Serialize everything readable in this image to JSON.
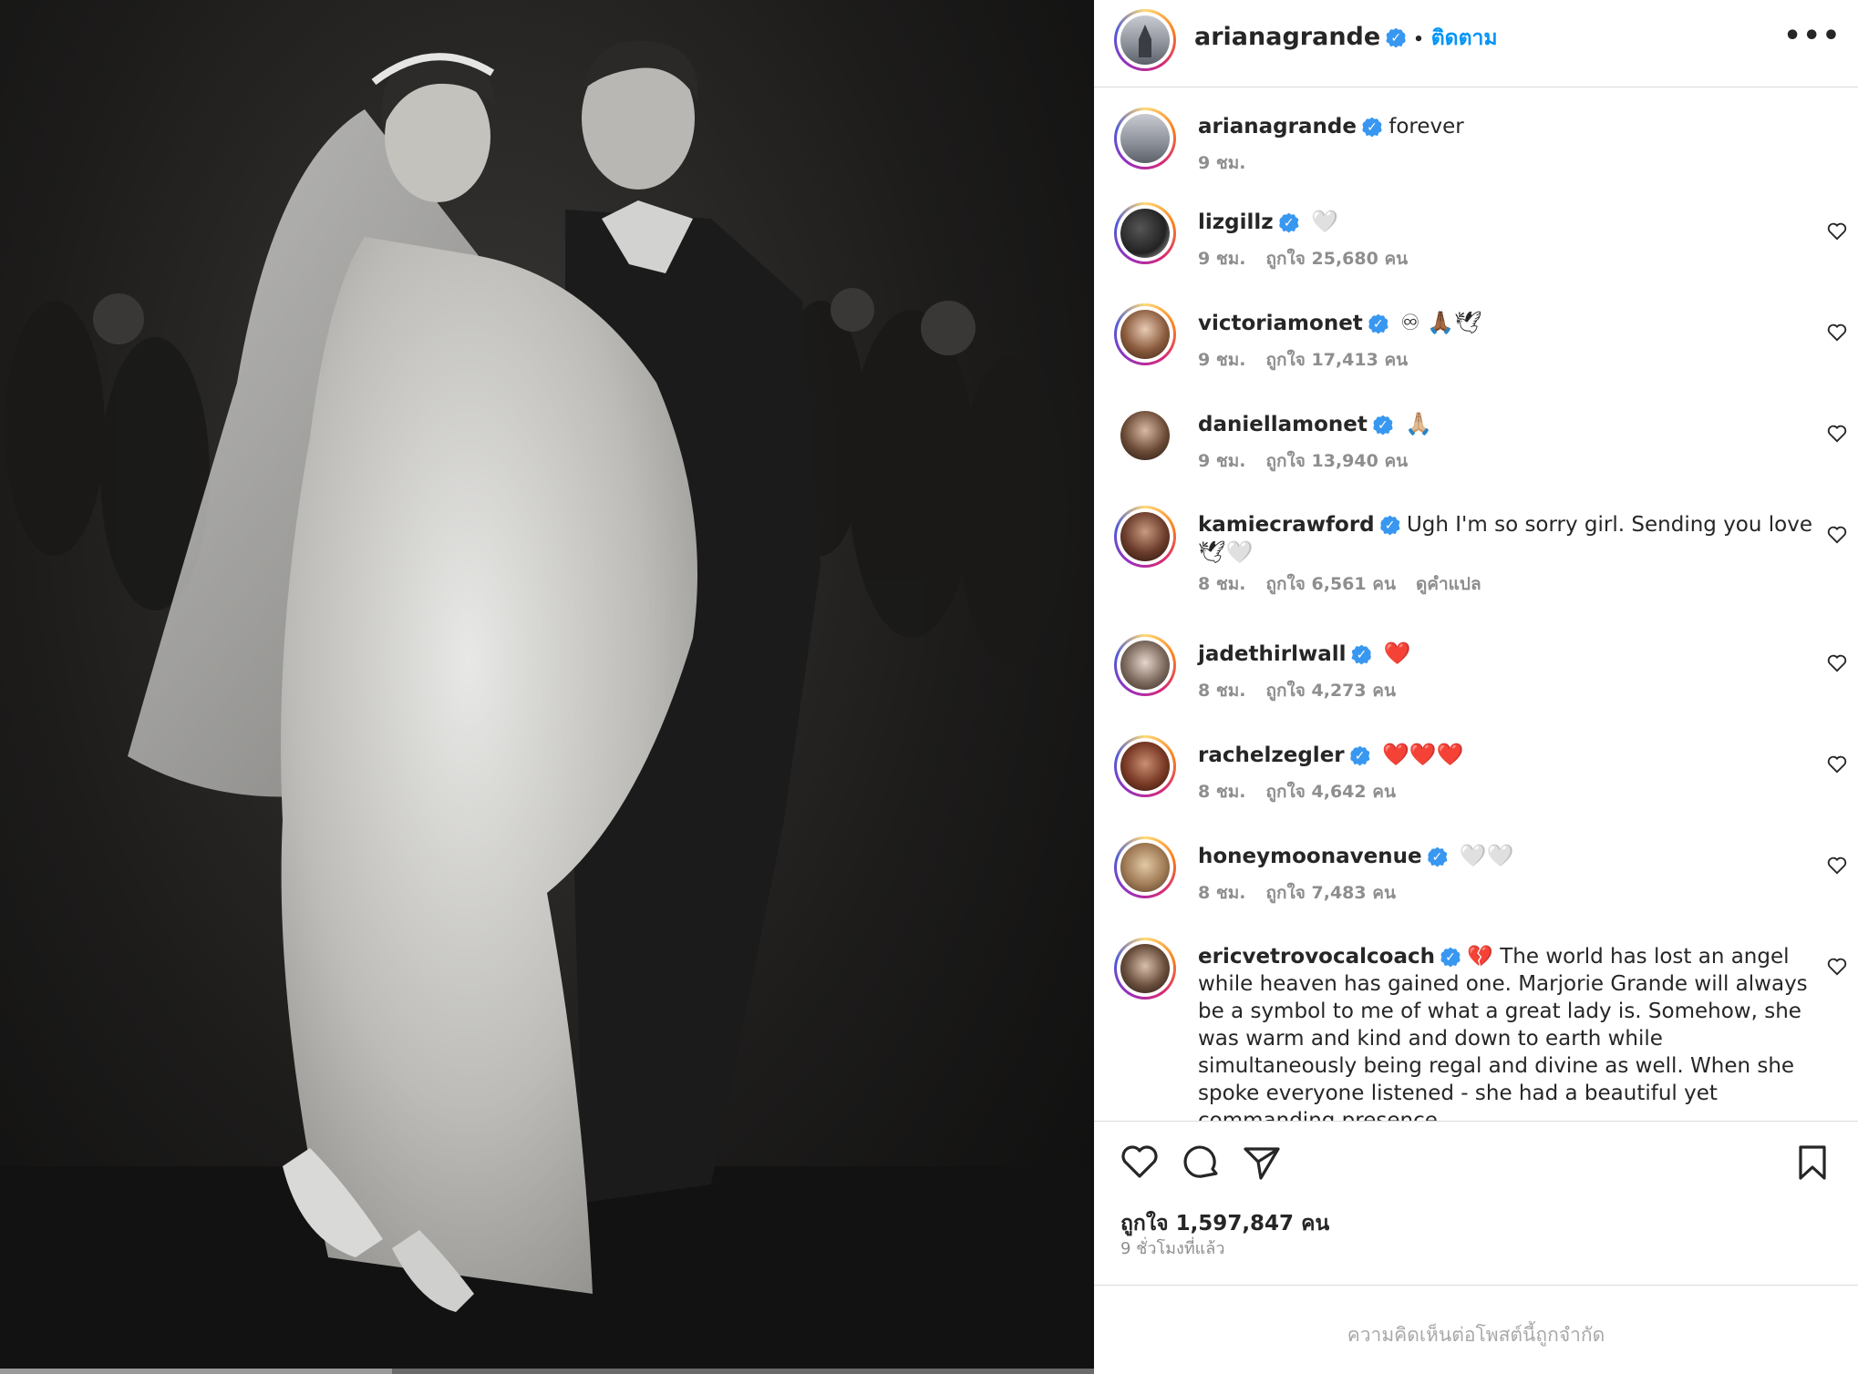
{
  "post": {
    "author": "arianagrande",
    "follow_label": "ติดตาม",
    "dot": "•",
    "more_icon": "more-options-icon",
    "more_text": "•••",
    "caption": {
      "user": "arianagrande",
      "text": "forever",
      "time": "9 ชม."
    }
  },
  "comments": [
    {
      "user": "lizgillz",
      "text": "",
      "emoji": "🤍",
      "time": "9 ชม.",
      "likes": "ถูกใจ 25,680 คน",
      "extra": ""
    },
    {
      "user": "victoriamonet",
      "text": "",
      "emoji": "♾ 🙏🏾🕊",
      "time": "9 ชม.",
      "likes": "ถูกใจ 17,413 คน",
      "extra": ""
    },
    {
      "user": "daniellamonet",
      "text": "",
      "emoji": "🙏🏼",
      "time": "9 ชม.",
      "likes": "ถูกใจ 13,940 คน",
      "extra": ""
    },
    {
      "user": "kamiecrawford",
      "text": "Ugh I'm so sorry girl. Sending you love",
      "emoji": "🕊🤍",
      "time": "8 ชม.",
      "likes": "ถูกใจ 6,561 คน",
      "extra": "ดูคำแปล"
    },
    {
      "user": "jadethirlwall",
      "text": "",
      "emoji": "❤️",
      "time": "8 ชม.",
      "likes": "ถูกใจ 4,273 คน",
      "extra": ""
    },
    {
      "user": "rachelzegler",
      "text": "",
      "emoji": "❤️❤️❤️",
      "time": "8 ชม.",
      "likes": "ถูกใจ 4,642 คน",
      "extra": ""
    },
    {
      "user": "honeymoonavenue",
      "text": "",
      "emoji": "🤍🤍",
      "time": "8 ชม.",
      "likes": "ถูกใจ 7,483 คน",
      "extra": ""
    },
    {
      "user": "ericvetrovocalcoach",
      "text": "💔 The world has lost an angel while heaven has gained one. Marjorie Grande will always be a symbol to me of what a great lady is. Somehow, she was warm and kind and down to earth while simultaneously being regal and divine as well. When she spoke everyone listened - she had a beautiful yet commanding presence",
      "emoji": "",
      "time": "",
      "likes": "",
      "extra": ""
    }
  ],
  "actions": {
    "like_icon": "heart-icon",
    "comment_icon": "comment-icon",
    "share_icon": "send-icon",
    "save_icon": "bookmark-icon",
    "likes": "ถูกใจ 1,597,847 คน",
    "time": "9 ชั่วโมงที่แล้ว"
  },
  "comments_limited": "ความคิดเห็นต่อโพสต์นี้ถูกจำกัด",
  "colors": {
    "link": "#0095f6",
    "verified": "#3897f0",
    "muted": "#8e8e8e",
    "border": "#dbdbdb"
  }
}
